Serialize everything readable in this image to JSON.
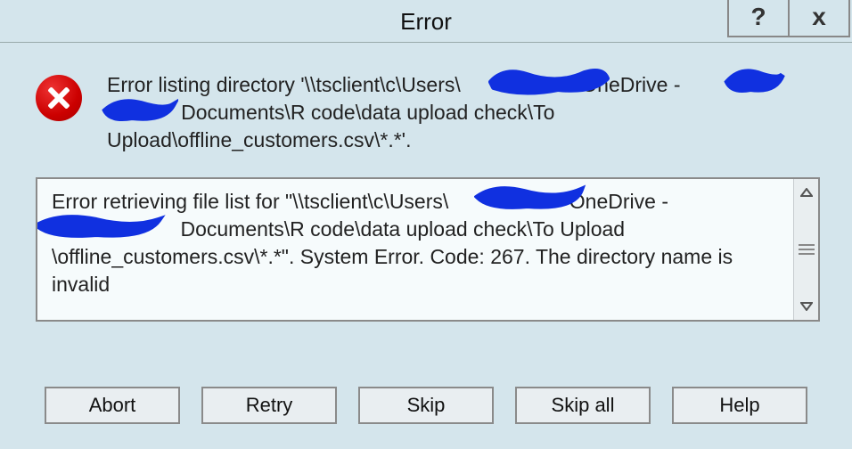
{
  "title": "Error",
  "titlebar": {
    "help_label": "?",
    "close_label": "x"
  },
  "message": {
    "line1_a": "Error listing directory '\\\\tsclient\\c\\Users\\",
    "line1_b": "OneDrive -",
    "line2_b": "Documents\\R code\\data upload check\\To",
    "line3": "Upload\\offline_customers.csv\\*.*'."
  },
  "details": {
    "line1_a": "Error retrieving file list for \"\\\\tsclient\\c\\Users\\",
    "line1_b": "OneDrive -",
    "line2_b": "Documents\\R code\\data upload check\\To Upload",
    "line3": "\\offline_customers.csv\\*.*\".",
    "line4": "System Error.  Code: 267.",
    "line5": "The directory name is invalid"
  },
  "buttons": {
    "abort": "Abort",
    "retry": "Retry",
    "skip": "Skip",
    "skipall": "Skip all",
    "help": "Help"
  }
}
